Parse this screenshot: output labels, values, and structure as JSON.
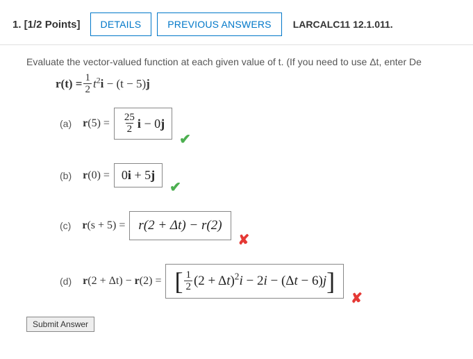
{
  "header": {
    "question_label": "1. [1/2 Points]",
    "details_btn": "DETAILS",
    "prev_answers_btn": "PREVIOUS ANSWERS",
    "source": "LARCALC11 12.1.011."
  },
  "prompt": "Evaluate the vector-valued function at each given value of t. (If you need to use Δt, enter De",
  "function_def": {
    "lhs": "r(t) = ",
    "frac_num": "1",
    "frac_den": "2",
    "after_frac": "t",
    "exp": "2",
    "i": "i",
    "tail": " − (t − 5)",
    "j": "j"
  },
  "parts": {
    "a": {
      "label": "(a)",
      "lhs_pre": "r",
      "lhs_arg": "(5) = ",
      "ans_frac_num": "25",
      "ans_frac_den": "2",
      "ans_i": "i",
      "ans_mid": " − 0",
      "ans_j": "j",
      "mark": "✔",
      "correct": true
    },
    "b": {
      "label": "(b)",
      "lhs_pre": "r",
      "lhs_arg": "(0) = ",
      "ans_pre": "0",
      "ans_i": "i",
      "ans_mid": " + 5",
      "ans_j": "j",
      "mark": "✔",
      "correct": true
    },
    "c": {
      "label": "(c)",
      "lhs_pre": "r",
      "lhs_arg": "(s + 5) = ",
      "ans": "r(2 + Δt) − r(2)",
      "mark": "✘",
      "correct": false
    },
    "d": {
      "label": "(d)",
      "lhs_pre": "r",
      "lhs_mid1": "(2 + Δt) − ",
      "lhs_pre2": "r",
      "lhs_mid2": "(2) = ",
      "ans_lbracket": "[",
      "ans_frac_num": "1",
      "ans_frac_den": "2",
      "ans_p1": "(2 + Δ",
      "ans_t": "t",
      "ans_p2": ")",
      "ans_exp": "2",
      "ans_i": "i",
      "ans_mid": " − 2",
      "ans_i2": "i",
      "ans_mid2": " − (Δ",
      "ans_t2": "t",
      "ans_mid3": " − 6)",
      "ans_j": "j",
      "ans_rbracket": "]",
      "mark": "✘",
      "correct": false
    }
  },
  "submit_label": "Submit Answer"
}
